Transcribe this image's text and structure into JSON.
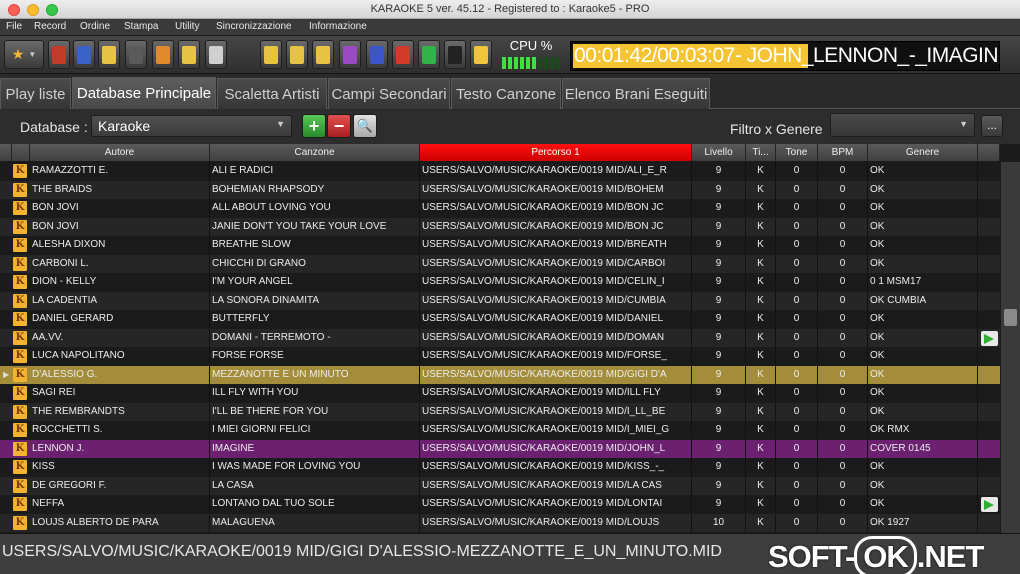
{
  "window": {
    "title": "KARAOKE 5   ver. 45.12 - Registered to : Karaoke5 - PRO"
  },
  "menu": [
    "File",
    "Record",
    "Ordine",
    "Stampa",
    "Utility",
    "Sincronizzazione",
    "Informazione"
  ],
  "toolbar": {
    "favorites_icon": "star-icon",
    "buttons": [
      {
        "name": "guitar-icon",
        "color": "#c23b2b"
      },
      {
        "name": "music-note-icon",
        "color": "#3a62c8"
      },
      {
        "name": "pencil-icon",
        "color": "#e7c243"
      },
      {
        "name": "film-icon",
        "color": "#5a5a5a"
      },
      {
        "name": "edit-document-icon",
        "color": "#e08a2e"
      },
      {
        "name": "hand-icon",
        "color": "#e7c243"
      },
      {
        "name": "padlock-icon",
        "color": "#cfcfcf"
      },
      {
        "name": "calculator-icon",
        "color": "#e7c243"
      },
      {
        "name": "magnifier-icon",
        "color": "#e7c243"
      },
      {
        "name": "folder-music-icon",
        "color": "#e7c243"
      },
      {
        "name": "screen-icon",
        "color": "#9a4bc2"
      },
      {
        "name": "display-icon",
        "color": "#3a56c8"
      },
      {
        "name": "no-entry-icon",
        "color": "#d23b2b"
      },
      {
        "name": "play-icon",
        "color": "#31b34a"
      },
      {
        "name": "stop-icon",
        "color": "#222222"
      },
      {
        "name": "pause-icon",
        "color": "#f0c53a"
      }
    ],
    "cpu_label": "CPU %",
    "cpu_level": 0.55,
    "time": "00:01:42/00:03:07- JOHN",
    "now_playing": "_LENNON_-_IMAGIN"
  },
  "tabs": [
    {
      "label": "Play liste",
      "active": false
    },
    {
      "label": "Database Principale",
      "active": true
    },
    {
      "label": "Scaletta Artisti",
      "active": false
    },
    {
      "label": "Campi Secondari",
      "active": false
    },
    {
      "label": "Testo Canzone",
      "active": false
    },
    {
      "label": "Elenco Brani Eseguiti",
      "active": false
    }
  ],
  "database": {
    "label": "Database :",
    "selected": "Karaoke",
    "filter_label": "Filtro x Genere",
    "filter_value": "",
    "more_label": "..."
  },
  "columns": [
    "Autore",
    "Canzone",
    "Percorso 1",
    "Livello",
    "Ti...",
    "Tone",
    "BPM",
    "Genere"
  ],
  "rows": [
    {
      "autore": "RAMAZZOTTI E.",
      "canzone": "ALI E RADICI",
      "percorso": "USERS/SALVO/MUSIC/KARAOKE/0019 MID/ALI_E_R",
      "livello": "9",
      "tipo": "K",
      "tone": "0",
      "bpm": "0",
      "genere": "OK"
    },
    {
      "autore": "THE BRAIDS",
      "canzone": "BOHEMIAN RHAPSODY",
      "percorso": "USERS/SALVO/MUSIC/KARAOKE/0019 MID/BOHEM",
      "livello": "9",
      "tipo": "K",
      "tone": "0",
      "bpm": "0",
      "genere": "OK"
    },
    {
      "autore": "BON JOVI",
      "canzone": "ALL ABOUT LOVING YOU",
      "percorso": "USERS/SALVO/MUSIC/KARAOKE/0019 MID/BON JC",
      "livello": "9",
      "tipo": "K",
      "tone": "0",
      "bpm": "0",
      "genere": "OK"
    },
    {
      "autore": "BON JOVI",
      "canzone": "JANIE DON'T YOU TAKE YOUR LOVE",
      "percorso": "USERS/SALVO/MUSIC/KARAOKE/0019 MID/BON JC",
      "livello": "9",
      "tipo": "K",
      "tone": "0",
      "bpm": "0",
      "genere": "OK"
    },
    {
      "autore": "ALESHA DIXON",
      "canzone": "BREATHE SLOW",
      "percorso": "USERS/SALVO/MUSIC/KARAOKE/0019 MID/BREATH",
      "livello": "9",
      "tipo": "K",
      "tone": "0",
      "bpm": "0",
      "genere": "OK"
    },
    {
      "autore": "CARBONI L.",
      "canzone": "CHICCHI DI GRANO",
      "percorso": "USERS/SALVO/MUSIC/KARAOKE/0019 MID/CARBOI",
      "livello": "9",
      "tipo": "K",
      "tone": "0",
      "bpm": "0",
      "genere": "OK"
    },
    {
      "autore": "DION - KELLY",
      "canzone": "I'M YOUR ANGEL",
      "percorso": "USERS/SALVO/MUSIC/KARAOKE/0019 MID/CELIN_I",
      "livello": "9",
      "tipo": "K",
      "tone": "0",
      "bpm": "0",
      "genere": "0 1 MSM17"
    },
    {
      "autore": "LA CADENTIA",
      "canzone": "LA SONORA DINAMITA",
      "percorso": "USERS/SALVO/MUSIC/KARAOKE/0019 MID/CUMBIA",
      "livello": "9",
      "tipo": "K",
      "tone": "0",
      "bpm": "0",
      "genere": "OK CUMBIA"
    },
    {
      "autore": "DANIEL GERARD",
      "canzone": "BUTTERFLY",
      "percorso": "USERS/SALVO/MUSIC/KARAOKE/0019 MID/DANIEL",
      "livello": "9",
      "tipo": "K",
      "tone": "0",
      "bpm": "0",
      "genere": "OK"
    },
    {
      "autore": "AA.VV.",
      "canzone": "DOMANI - TERREMOTO -",
      "percorso": "USERS/SALVO/MUSIC/KARAOKE/0019 MID/DOMAN",
      "livello": "9",
      "tipo": "K",
      "tone": "0",
      "bpm": "0",
      "genere": "OK"
    },
    {
      "autore": "LUCA NAPOLITANO",
      "canzone": "FORSE FORSE",
      "percorso": "USERS/SALVO/MUSIC/KARAOKE/0019 MID/FORSE_",
      "livello": "9",
      "tipo": "K",
      "tone": "0",
      "bpm": "0",
      "genere": "OK"
    },
    {
      "autore": "D'ALESSIO G.",
      "canzone": "MEZZANOTTE E UN MINUTO",
      "percorso": "USERS/SALVO/MUSIC/KARAOKE/0019 MID/GIGI D'A",
      "livello": "9",
      "tipo": "K",
      "tone": "0",
      "bpm": "0",
      "genere": "OK"
    },
    {
      "autore": "SAGI REI",
      "canzone": "ILL FLY WITH YOU",
      "percorso": "USERS/SALVO/MUSIC/KARAOKE/0019 MID/ILL FLY",
      "livello": "9",
      "tipo": "K",
      "tone": "0",
      "bpm": "0",
      "genere": "OK"
    },
    {
      "autore": "THE REMBRANDTS",
      "canzone": "I'LL BE THERE FOR YOU",
      "percorso": "USERS/SALVO/MUSIC/KARAOKE/0019 MID/I_LL_BE",
      "livello": "9",
      "tipo": "K",
      "tone": "0",
      "bpm": "0",
      "genere": "OK"
    },
    {
      "autore": "ROCCHETTI S.",
      "canzone": "I MIEI GIORNI FELICI",
      "percorso": "USERS/SALVO/MUSIC/KARAOKE/0019 MID/I_MIEI_G",
      "livello": "9",
      "tipo": "K",
      "tone": "0",
      "bpm": "0",
      "genere": "OK RMX"
    },
    {
      "autore": "LENNON J.",
      "canzone": "IMAGINE",
      "percorso": "USERS/SALVO/MUSIC/KARAOKE/0019 MID/JOHN_L",
      "livello": "9",
      "tipo": "K",
      "tone": "0",
      "bpm": "0",
      "genere": "COVER 0145"
    },
    {
      "autore": "KISS",
      "canzone": "I WAS MADE FOR LOVING YOU",
      "percorso": "USERS/SALVO/MUSIC/KARAOKE/0019 MID/KISS_-_",
      "livello": "9",
      "tipo": "K",
      "tone": "0",
      "bpm": "0",
      "genere": "OK"
    },
    {
      "autore": "DE GREGORI F.",
      "canzone": "LA CASA",
      "percorso": "USERS/SALVO/MUSIC/KARAOKE/0019 MID/LA CAS",
      "livello": "9",
      "tipo": "K",
      "tone": "0",
      "bpm": "0",
      "genere": "OK"
    },
    {
      "autore": "NEFFA",
      "canzone": "LONTANO DAL TUO SOLE",
      "percorso": "USERS/SALVO/MUSIC/KARAOKE/0019 MID/LONTAI",
      "livello": "9",
      "tipo": "K",
      "tone": "0",
      "bpm": "0",
      "genere": "OK"
    },
    {
      "autore": "LOUJS ALBERTO DE PARA",
      "canzone": "MALAGUENA",
      "percorso": "USERS/SALVO/MUSIC/KARAOKE/0019 MID/LOUJS",
      "livello": "10",
      "tipo": "K",
      "tone": "0",
      "bpm": "0",
      "genere": "OK 1927"
    }
  ],
  "row_icon_letter": "K",
  "row_marker": "▶",
  "status": {
    "path": "USERS/SALVO/MUSIC/KARAOKE/0019 MID/GIGI D'ALESSIO-MEZZANOTTE_E_UN_MINUTO.MID"
  },
  "watermark": {
    "prefix": "SOFT-",
    "ok": "OK",
    "suffix": ".NET"
  },
  "colors": {
    "selected_row": "#a48d3a",
    "playing_row": "#6b2070",
    "path_header": "#ee1111",
    "lcd_highlight": "#f4c433"
  }
}
